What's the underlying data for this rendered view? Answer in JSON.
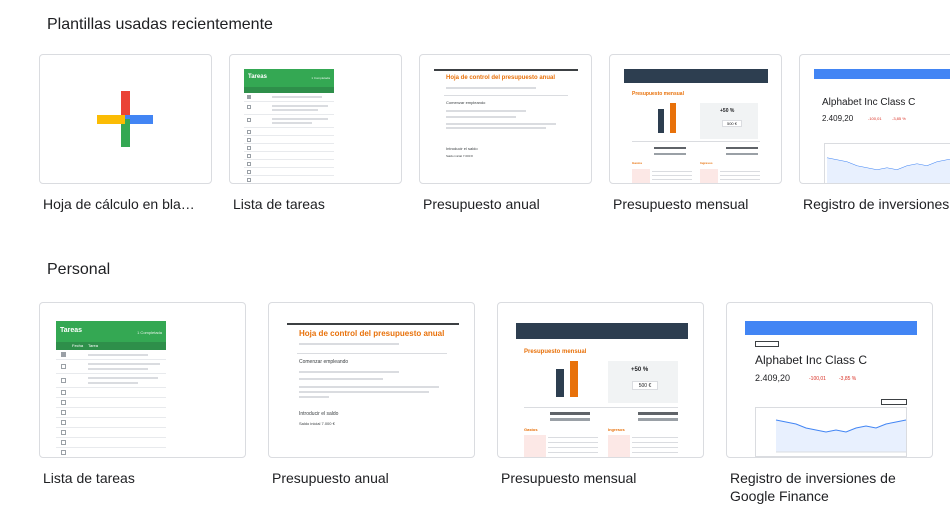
{
  "sections": {
    "recent": {
      "title": "Plantillas usadas recientemente",
      "templates": [
        {
          "label": "Hoja de cálculo en bla…",
          "icon": "plus-icon"
        },
        {
          "label": "Lista de tareas"
        },
        {
          "label": "Presupuesto anual"
        },
        {
          "label": "Presupuesto mensual"
        },
        {
          "label": "Registro de inversiones"
        }
      ]
    },
    "personal": {
      "title": "Personal",
      "templates": [
        {
          "label": "Lista de tareas"
        },
        {
          "label": "Presupuesto anual"
        },
        {
          "label": "Presupuesto mensual"
        },
        {
          "label": "Registro de inversiones de Google Finance"
        }
      ]
    }
  },
  "thumbs": {
    "tasks": {
      "title": "Tareas",
      "count": "1 Completada",
      "col1": "Fecha",
      "col2": "Tarea"
    },
    "annual": {
      "title": "Hoja de control del presupuesto anual",
      "subtitle": "Comenzar empleando",
      "footer": "Introducir el saldo",
      "footer2": "Saldo inicial",
      "footer_value": "7.000 €"
    },
    "monthly": {
      "title": "Presupuesto mensual",
      "pct": "+50 %",
      "amount": "500 €",
      "expenses": "Gastos",
      "income": "Ingresos"
    },
    "finance": {
      "name": "Alphabet Inc Class C",
      "price": "2.409,20",
      "change": "-100,01",
      "change_pct": "-3,85 %"
    }
  },
  "colors": {
    "green": "#34a853",
    "blue": "#4285f4",
    "red": "#ea4335",
    "yellow": "#fbbc04",
    "orange": "#e8710a",
    "navy": "#2d3e50"
  }
}
